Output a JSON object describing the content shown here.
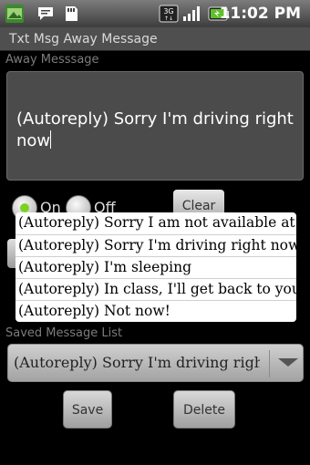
{
  "status_bar": {
    "time": "11:02 PM",
    "icons": [
      "gallery-icon",
      "message-icon",
      "sd-card-icon",
      "3g-icon",
      "signal-icon",
      "battery-icon"
    ]
  },
  "app": {
    "title": "Txt Msg Away Message"
  },
  "away_message": {
    "label": "Away Messsage",
    "text": "(Autoreply) Sorry I'm driving right now"
  },
  "controls": {
    "on_label": "On",
    "off_label": "Off",
    "clear_label": "Clear"
  },
  "popup_options": [
    "(Autoreply) Sorry I am not available at th",
    "(Autoreply) Sorry I'm driving right now",
    "(Autoreply) I'm sleeping",
    "(Autoreply) In class, I'll get back to you",
    "(Autoreply) Not now!"
  ],
  "saved_list": {
    "label": "Saved Message List",
    "selected": "(Autoreply) Sorry I'm driving right now"
  },
  "buttons": {
    "save": "Save",
    "delete": "Delete"
  },
  "colors": {
    "radio_on": "#7bd321",
    "battery": "#5fbf2a"
  }
}
